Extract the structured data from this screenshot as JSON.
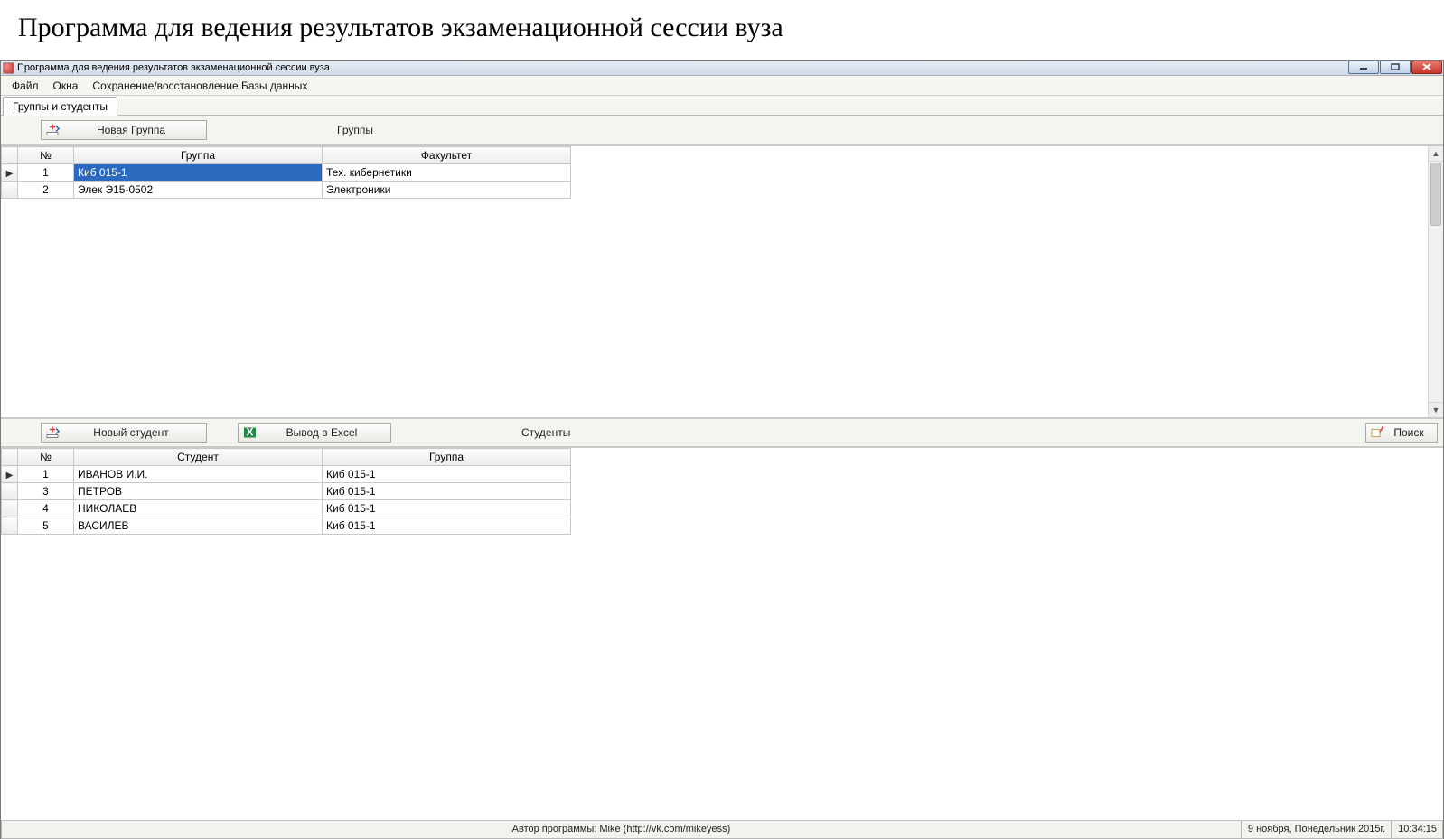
{
  "page_heading": "Программа для ведения результатов экзаменационной сессии вуза",
  "window_title": "Программа для ведения результатов экзаменационной сессии вуза",
  "menu": {
    "file": "Файл",
    "windows": "Окна",
    "backup": "Сохранение/восстановление Базы данных"
  },
  "tab_groups_students": "Группы и студенты",
  "groups": {
    "new_button": "Новая Группа",
    "section_label": "Группы",
    "columns": {
      "num": "№",
      "group": "Группа",
      "faculty": "Факультет"
    },
    "rows": [
      {
        "num": "1",
        "group": "Киб 015-1",
        "faculty": "Тех. кибернетики",
        "selected": true
      },
      {
        "num": "2",
        "group": "Элек Э15-0502",
        "faculty": "Электроники",
        "selected": false
      }
    ]
  },
  "students": {
    "new_button": "Новый студент",
    "export_button": "Вывод в Excel",
    "section_label": "Студенты",
    "search_button": "Поиск",
    "columns": {
      "num": "№",
      "student": "Студент",
      "group": "Группа"
    },
    "rows": [
      {
        "num": "1",
        "student": "ИВАНОВ И.И.",
        "group": "Киб 015-1"
      },
      {
        "num": "3",
        "student": "ПЕТРОВ",
        "group": "Киб 015-1"
      },
      {
        "num": "4",
        "student": "НИКОЛАЕВ",
        "group": "Киб 015-1"
      },
      {
        "num": "5",
        "student": "ВАСИЛЕВ",
        "group": "Киб 015-1"
      }
    ]
  },
  "status_bar": {
    "author": "Автор программы: Mike (http://vk.com/mikeyess)",
    "date": "9 ноября, Понедельник 2015г.",
    "time": "10:34:15"
  }
}
